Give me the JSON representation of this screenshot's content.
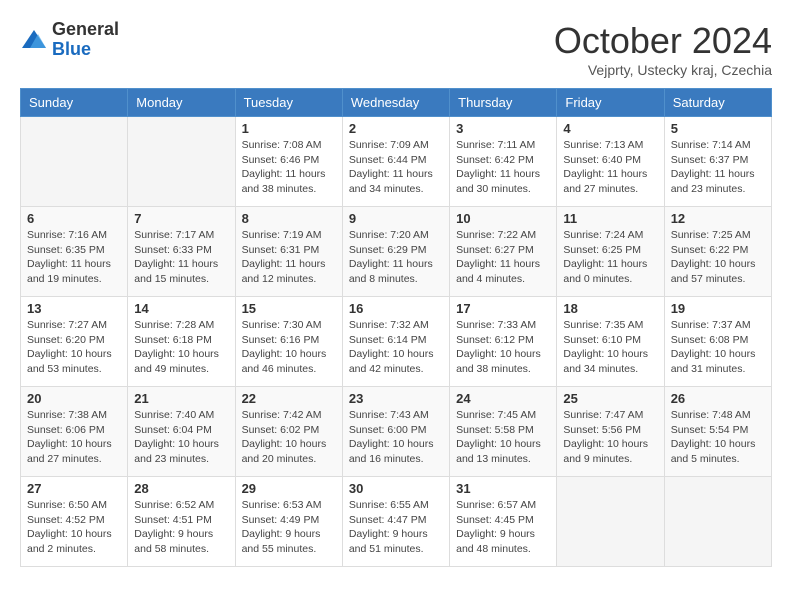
{
  "logo": {
    "general": "General",
    "blue": "Blue"
  },
  "header": {
    "month": "October 2024",
    "location": "Vejprty, Ustecky kraj, Czechia"
  },
  "weekdays": [
    "Sunday",
    "Monday",
    "Tuesday",
    "Wednesday",
    "Thursday",
    "Friday",
    "Saturday"
  ],
  "weeks": [
    [
      {
        "day": "",
        "info": ""
      },
      {
        "day": "",
        "info": ""
      },
      {
        "day": "1",
        "info": "Sunrise: 7:08 AM\nSunset: 6:46 PM\nDaylight: 11 hours and 38 minutes."
      },
      {
        "day": "2",
        "info": "Sunrise: 7:09 AM\nSunset: 6:44 PM\nDaylight: 11 hours and 34 minutes."
      },
      {
        "day": "3",
        "info": "Sunrise: 7:11 AM\nSunset: 6:42 PM\nDaylight: 11 hours and 30 minutes."
      },
      {
        "day": "4",
        "info": "Sunrise: 7:13 AM\nSunset: 6:40 PM\nDaylight: 11 hours and 27 minutes."
      },
      {
        "day": "5",
        "info": "Sunrise: 7:14 AM\nSunset: 6:37 PM\nDaylight: 11 hours and 23 minutes."
      }
    ],
    [
      {
        "day": "6",
        "info": "Sunrise: 7:16 AM\nSunset: 6:35 PM\nDaylight: 11 hours and 19 minutes."
      },
      {
        "day": "7",
        "info": "Sunrise: 7:17 AM\nSunset: 6:33 PM\nDaylight: 11 hours and 15 minutes."
      },
      {
        "day": "8",
        "info": "Sunrise: 7:19 AM\nSunset: 6:31 PM\nDaylight: 11 hours and 12 minutes."
      },
      {
        "day": "9",
        "info": "Sunrise: 7:20 AM\nSunset: 6:29 PM\nDaylight: 11 hours and 8 minutes."
      },
      {
        "day": "10",
        "info": "Sunrise: 7:22 AM\nSunset: 6:27 PM\nDaylight: 11 hours and 4 minutes."
      },
      {
        "day": "11",
        "info": "Sunrise: 7:24 AM\nSunset: 6:25 PM\nDaylight: 11 hours and 0 minutes."
      },
      {
        "day": "12",
        "info": "Sunrise: 7:25 AM\nSunset: 6:22 PM\nDaylight: 10 hours and 57 minutes."
      }
    ],
    [
      {
        "day": "13",
        "info": "Sunrise: 7:27 AM\nSunset: 6:20 PM\nDaylight: 10 hours and 53 minutes."
      },
      {
        "day": "14",
        "info": "Sunrise: 7:28 AM\nSunset: 6:18 PM\nDaylight: 10 hours and 49 minutes."
      },
      {
        "day": "15",
        "info": "Sunrise: 7:30 AM\nSunset: 6:16 PM\nDaylight: 10 hours and 46 minutes."
      },
      {
        "day": "16",
        "info": "Sunrise: 7:32 AM\nSunset: 6:14 PM\nDaylight: 10 hours and 42 minutes."
      },
      {
        "day": "17",
        "info": "Sunrise: 7:33 AM\nSunset: 6:12 PM\nDaylight: 10 hours and 38 minutes."
      },
      {
        "day": "18",
        "info": "Sunrise: 7:35 AM\nSunset: 6:10 PM\nDaylight: 10 hours and 34 minutes."
      },
      {
        "day": "19",
        "info": "Sunrise: 7:37 AM\nSunset: 6:08 PM\nDaylight: 10 hours and 31 minutes."
      }
    ],
    [
      {
        "day": "20",
        "info": "Sunrise: 7:38 AM\nSunset: 6:06 PM\nDaylight: 10 hours and 27 minutes."
      },
      {
        "day": "21",
        "info": "Sunrise: 7:40 AM\nSunset: 6:04 PM\nDaylight: 10 hours and 23 minutes."
      },
      {
        "day": "22",
        "info": "Sunrise: 7:42 AM\nSunset: 6:02 PM\nDaylight: 10 hours and 20 minutes."
      },
      {
        "day": "23",
        "info": "Sunrise: 7:43 AM\nSunset: 6:00 PM\nDaylight: 10 hours and 16 minutes."
      },
      {
        "day": "24",
        "info": "Sunrise: 7:45 AM\nSunset: 5:58 PM\nDaylight: 10 hours and 13 minutes."
      },
      {
        "day": "25",
        "info": "Sunrise: 7:47 AM\nSunset: 5:56 PM\nDaylight: 10 hours and 9 minutes."
      },
      {
        "day": "26",
        "info": "Sunrise: 7:48 AM\nSunset: 5:54 PM\nDaylight: 10 hours and 5 minutes."
      }
    ],
    [
      {
        "day": "27",
        "info": "Sunrise: 6:50 AM\nSunset: 4:52 PM\nDaylight: 10 hours and 2 minutes."
      },
      {
        "day": "28",
        "info": "Sunrise: 6:52 AM\nSunset: 4:51 PM\nDaylight: 9 hours and 58 minutes."
      },
      {
        "day": "29",
        "info": "Sunrise: 6:53 AM\nSunset: 4:49 PM\nDaylight: 9 hours and 55 minutes."
      },
      {
        "day": "30",
        "info": "Sunrise: 6:55 AM\nSunset: 4:47 PM\nDaylight: 9 hours and 51 minutes."
      },
      {
        "day": "31",
        "info": "Sunrise: 6:57 AM\nSunset: 4:45 PM\nDaylight: 9 hours and 48 minutes."
      },
      {
        "day": "",
        "info": ""
      },
      {
        "day": "",
        "info": ""
      }
    ]
  ]
}
